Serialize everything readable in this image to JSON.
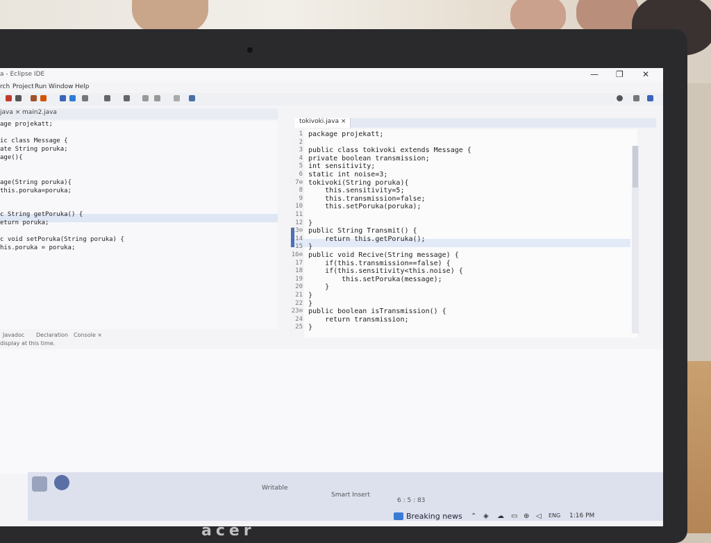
{
  "window": {
    "title": "a - Eclipse IDE",
    "controls": [
      "—",
      "❐",
      "✕"
    ]
  },
  "menu": [
    "rch",
    "Project",
    "Run",
    "Window",
    "Help"
  ],
  "left_tabs": [
    {
      "label": "java ×"
    },
    {
      "label": "main2.java"
    }
  ],
  "left_code": [
    "age projekatt;",
    "",
    "ic class Message {",
    "ate String poruka;",
    "age(){",
    "",
    "",
    "age(String poruka){",
    "this.poruka=poruka;",
    "",
    "",
    "c String getPoruka() {",
    "eturn poruka;",
    "",
    "c void setPoruka(String poruka) {",
    "his.poruka = poruka;"
  ],
  "right_tab": {
    "label": "tokivoki.java ×"
  },
  "right_code": [
    {
      "n": "1",
      "t": "package projekatt;"
    },
    {
      "n": "2",
      "t": ""
    },
    {
      "n": "3",
      "t": "public class tokivoki extends Message {"
    },
    {
      "n": "4",
      "t": "private boolean transmission;"
    },
    {
      "n": "5",
      "t": "int sensitivity;"
    },
    {
      "n": "6",
      "t": "static int noise=3;"
    },
    {
      "n": "7⊖",
      "t": "tokivoki(String poruka){"
    },
    {
      "n": "8",
      "t": "    this.sensitivity=5;"
    },
    {
      "n": "9",
      "t": "    this.transmission=false;"
    },
    {
      "n": "10",
      "t": "    this.setPoruka(poruka);"
    },
    {
      "n": "11",
      "t": ""
    },
    {
      "n": "12",
      "t": "}"
    },
    {
      "n": "13⊖",
      "t": "public String Transmit() {"
    },
    {
      "n": "14",
      "t": "    return this.getPoruka();"
    },
    {
      "n": "15",
      "t": "}"
    },
    {
      "n": "16⊖",
      "t": "public void Recive(String message) {"
    },
    {
      "n": "17",
      "t": "    if(this.transmission==false) {"
    },
    {
      "n": "18",
      "t": "    if(this.sensitivity<this.noise) {"
    },
    {
      "n": "19",
      "t": "        this.setPoruka(message);"
    },
    {
      "n": "20",
      "t": "    }"
    },
    {
      "n": "21",
      "t": "}"
    },
    {
      "n": "22",
      "t": "}"
    },
    {
      "n": "23⊖",
      "t": "public boolean isTransmission() {"
    },
    {
      "n": "24",
      "t": "    return transmission;"
    },
    {
      "n": "25",
      "t": "}"
    }
  ],
  "console": {
    "tabs": [
      "Javadoc",
      "Declaration",
      "Console ×"
    ],
    "message": "display at this time."
  },
  "status": {
    "writable": "Writable",
    "insert": "Smart Insert",
    "position": "6 : 5 : 83"
  },
  "taskbar": {
    "news": "Breaking news",
    "lang": "ENG",
    "time": "1:16 PM"
  },
  "brand": "acer"
}
